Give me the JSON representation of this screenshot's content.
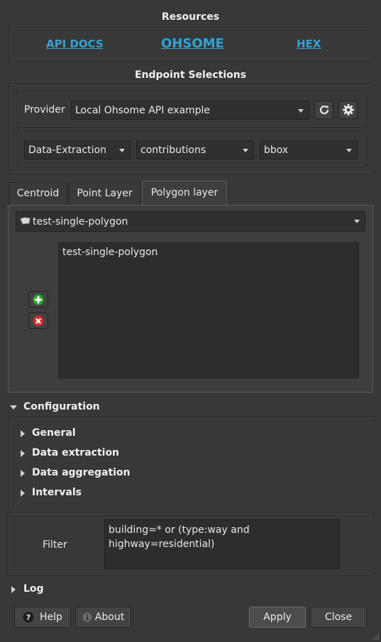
{
  "resources": {
    "title": "Resources",
    "links": [
      "API DOCS",
      "OHSOME",
      "HEX"
    ]
  },
  "endpoint": {
    "title": "Endpoint Selections",
    "provider_label": "Provider",
    "provider_value": "Local Ohsome API example",
    "type_value": "Data-Extraction",
    "endpoint_value": "contributions",
    "spatial_value": "bbox"
  },
  "tabs": [
    "Centroid",
    "Point Layer",
    "Polygon layer"
  ],
  "polygon": {
    "layer_value": "test-single-polygon",
    "list_items": [
      "test-single-polygon"
    ]
  },
  "configuration": {
    "title": "Configuration",
    "sections": [
      "General",
      "Data extraction",
      "Data aggregation",
      "Intervals"
    ]
  },
  "filter": {
    "label": "Filter",
    "value": "building=* or (type:way and\nhighway=residential)"
  },
  "log": {
    "label": "Log"
  },
  "buttons": {
    "help": "Help",
    "about": "About",
    "apply": "Apply",
    "close": "Close"
  },
  "colors": {
    "link": "#2fa4d8",
    "add_green": "#2ea52e",
    "remove_red": "#d42a2a"
  }
}
